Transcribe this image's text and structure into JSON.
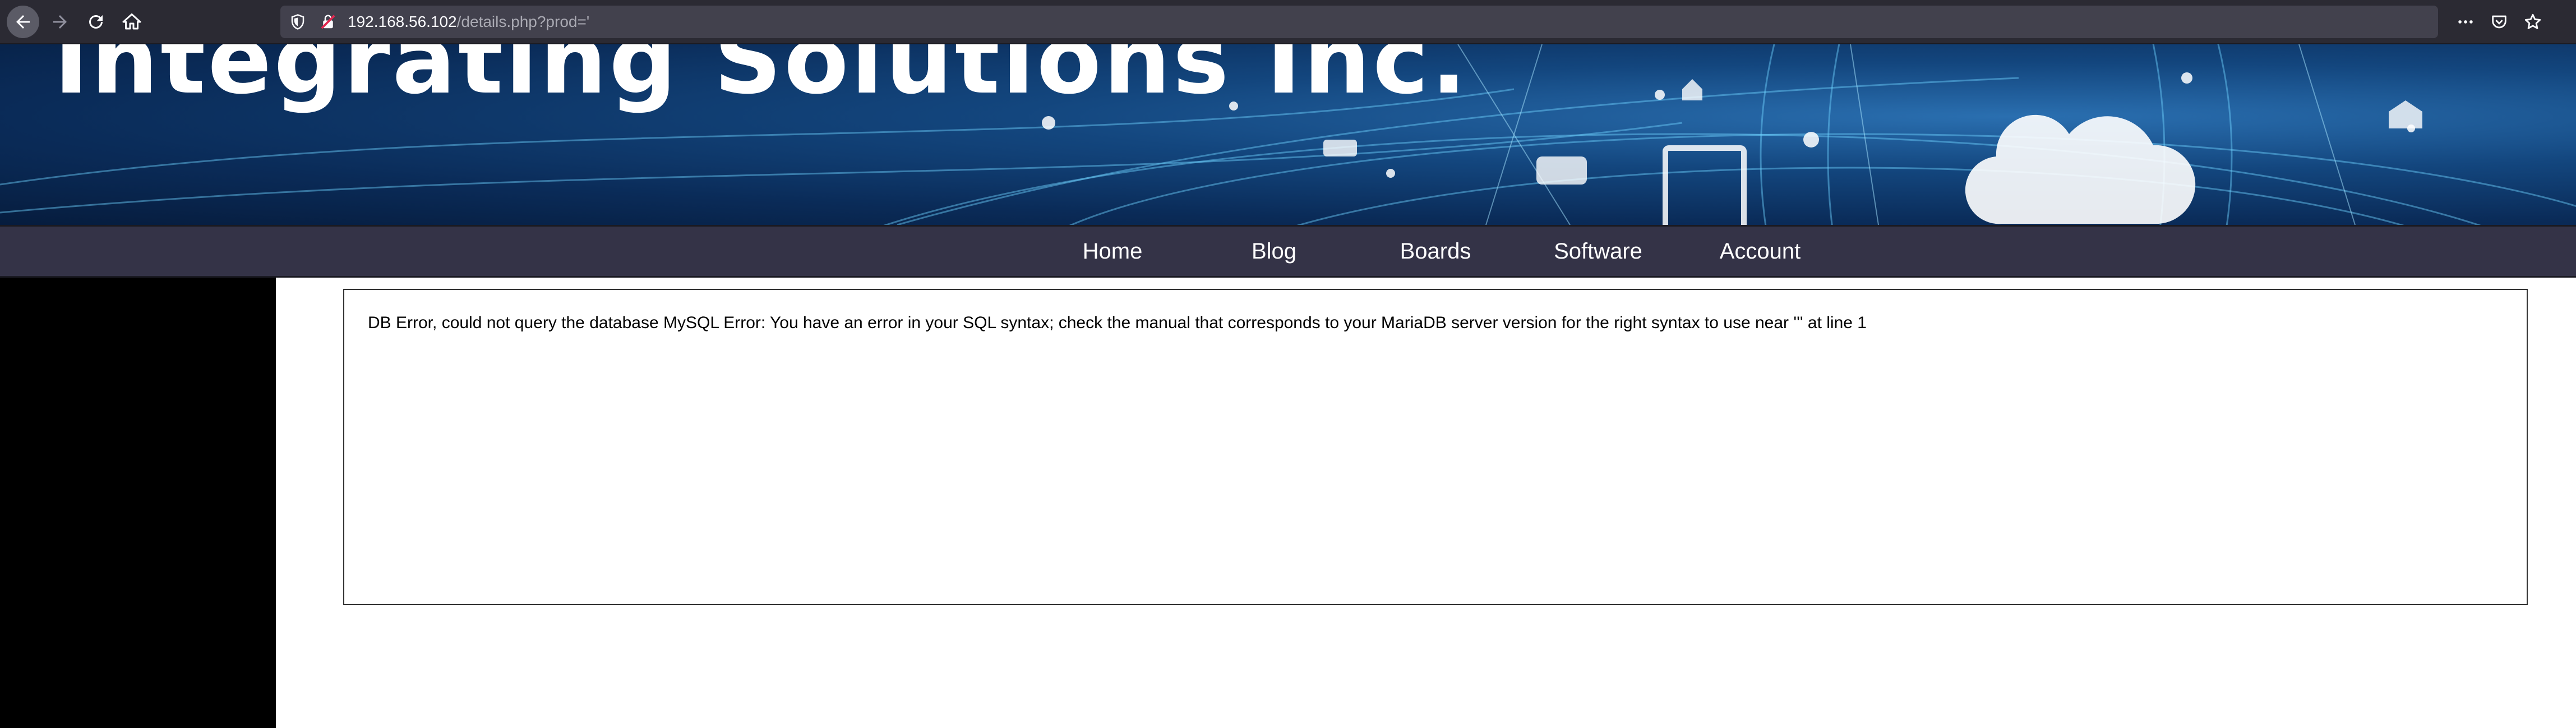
{
  "browser": {
    "url_host": "192.168.56.102",
    "url_path": "/details.php?prod='",
    "icons": {
      "back": "arrow-left-icon",
      "forward": "arrow-right-icon",
      "reload": "reload-icon",
      "home": "home-icon",
      "shield": "shield-icon",
      "insecure": "insecure-lock-icon",
      "more": "more-dots-icon",
      "pocket": "pocket-icon",
      "bookmark": "star-icon"
    }
  },
  "banner": {
    "title": "Integrating Solutions Inc."
  },
  "nav": {
    "items": [
      "Home",
      "Blog",
      "Boards",
      "Software",
      "Account"
    ]
  },
  "content": {
    "error_message": "DB Error, could not query the database MySQL Error: You have an error in your SQL syntax; check the manual that corresponds to your MariaDB server version for the right syntax to use near ''' at line 1"
  },
  "colors": {
    "chrome_bg": "#2b2a33",
    "urlbar_bg": "#42414d",
    "nav_bg": "#343347",
    "banner_bg": "#0a2b58",
    "left_panel": "#000000"
  }
}
